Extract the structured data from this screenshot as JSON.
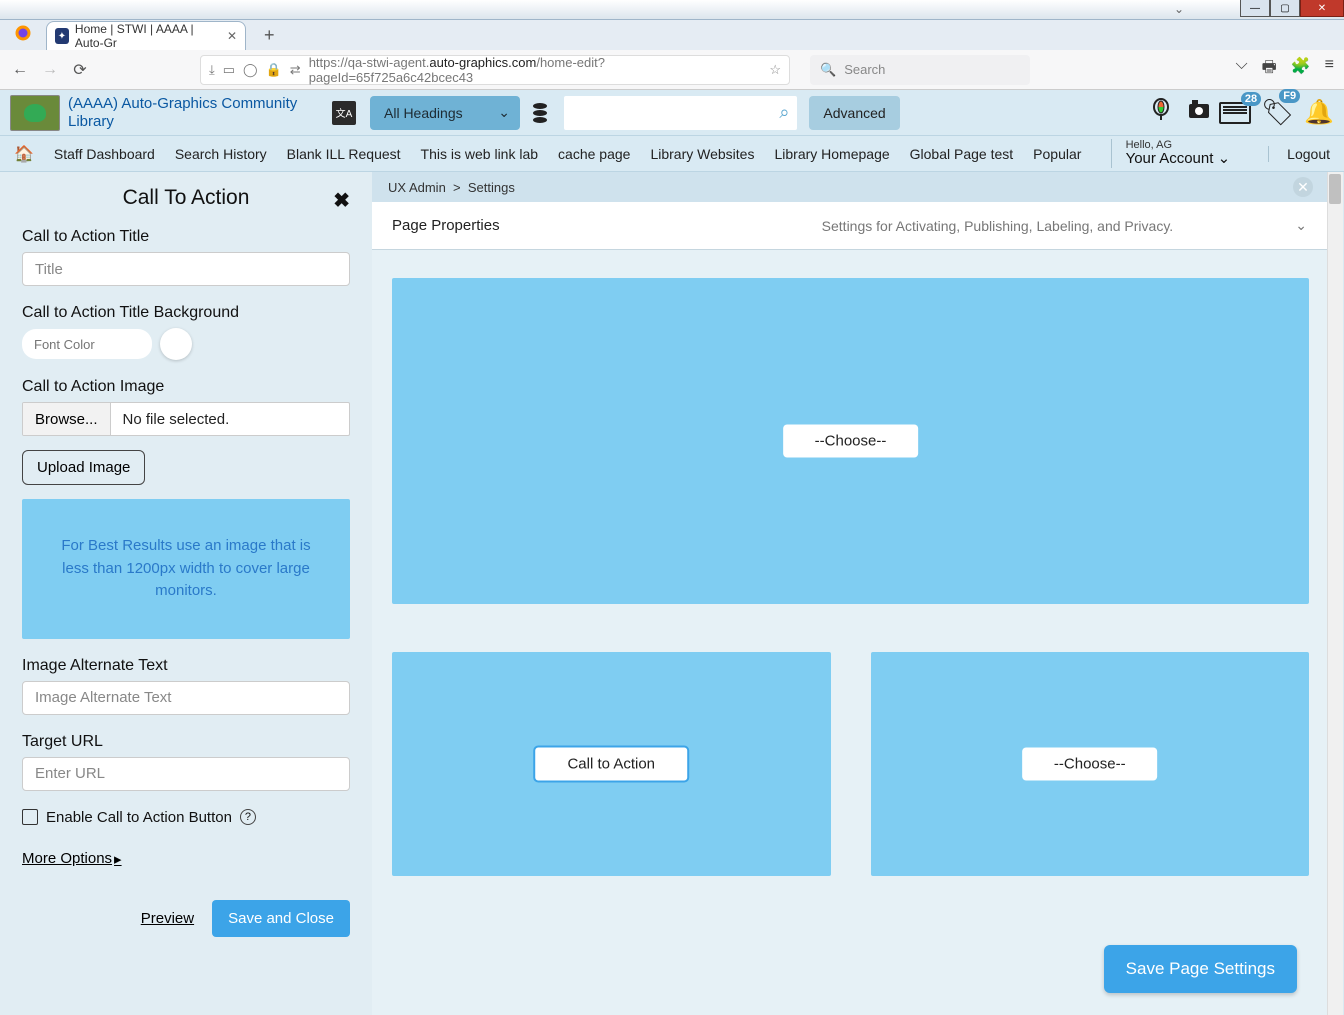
{
  "window": {
    "title_ghost": ""
  },
  "tab": {
    "title": "Home | STWI | AAAA | Auto-Gr"
  },
  "url": {
    "pre": "https://qa-stwi-agent.",
    "domain": "auto-graphics.com",
    "path": "/home-edit?pageId=65f725a6c42bcec43"
  },
  "search_placeholder": "Search",
  "library_name": "(AAAA) Auto-Graphics Community Library",
  "filter_label": "All Headings",
  "advanced_label": "Advanced",
  "badge_news": "28",
  "badge_fav": "F9",
  "nav": {
    "items": [
      "Staff Dashboard",
      "Search History",
      "Blank ILL Request",
      "This is web link lab",
      "cache page",
      "Library Websites",
      "Library Homepage",
      "Global Page test",
      "Popular"
    ],
    "hello": "Hello, AG",
    "account": "Your Account",
    "logout": "Logout"
  },
  "panel": {
    "title": "Call To Action",
    "fields": {
      "cta_title_label": "Call to Action Title",
      "cta_title_placeholder": "Title",
      "bg_label": "Call to Action Title Background",
      "bg_placeholder": "Font Color",
      "image_label": "Call to Action Image",
      "browse": "Browse...",
      "nofile": "No file selected.",
      "upload": "Upload Image",
      "tip": "For Best Results use an image that is less than 1200px width to cover large monitors.",
      "alt_label": "Image Alternate Text",
      "alt_placeholder": "Image Alternate Text",
      "url_label": "Target URL",
      "url_placeholder": "Enter URL",
      "enable_label": "Enable Call to Action Button",
      "more": "More Options",
      "preview": "Preview",
      "save": "Save and Close"
    }
  },
  "breadcrumb": {
    "a": "UX Admin",
    "sep": ">",
    "b": "Settings"
  },
  "propbar": {
    "title": "Page Properties",
    "desc": "Settings for Activating, Publishing, Labeling, and Privacy."
  },
  "widgets": {
    "choose": "--Choose--",
    "cta": "Call to Action"
  },
  "save_page": "Save Page Settings"
}
